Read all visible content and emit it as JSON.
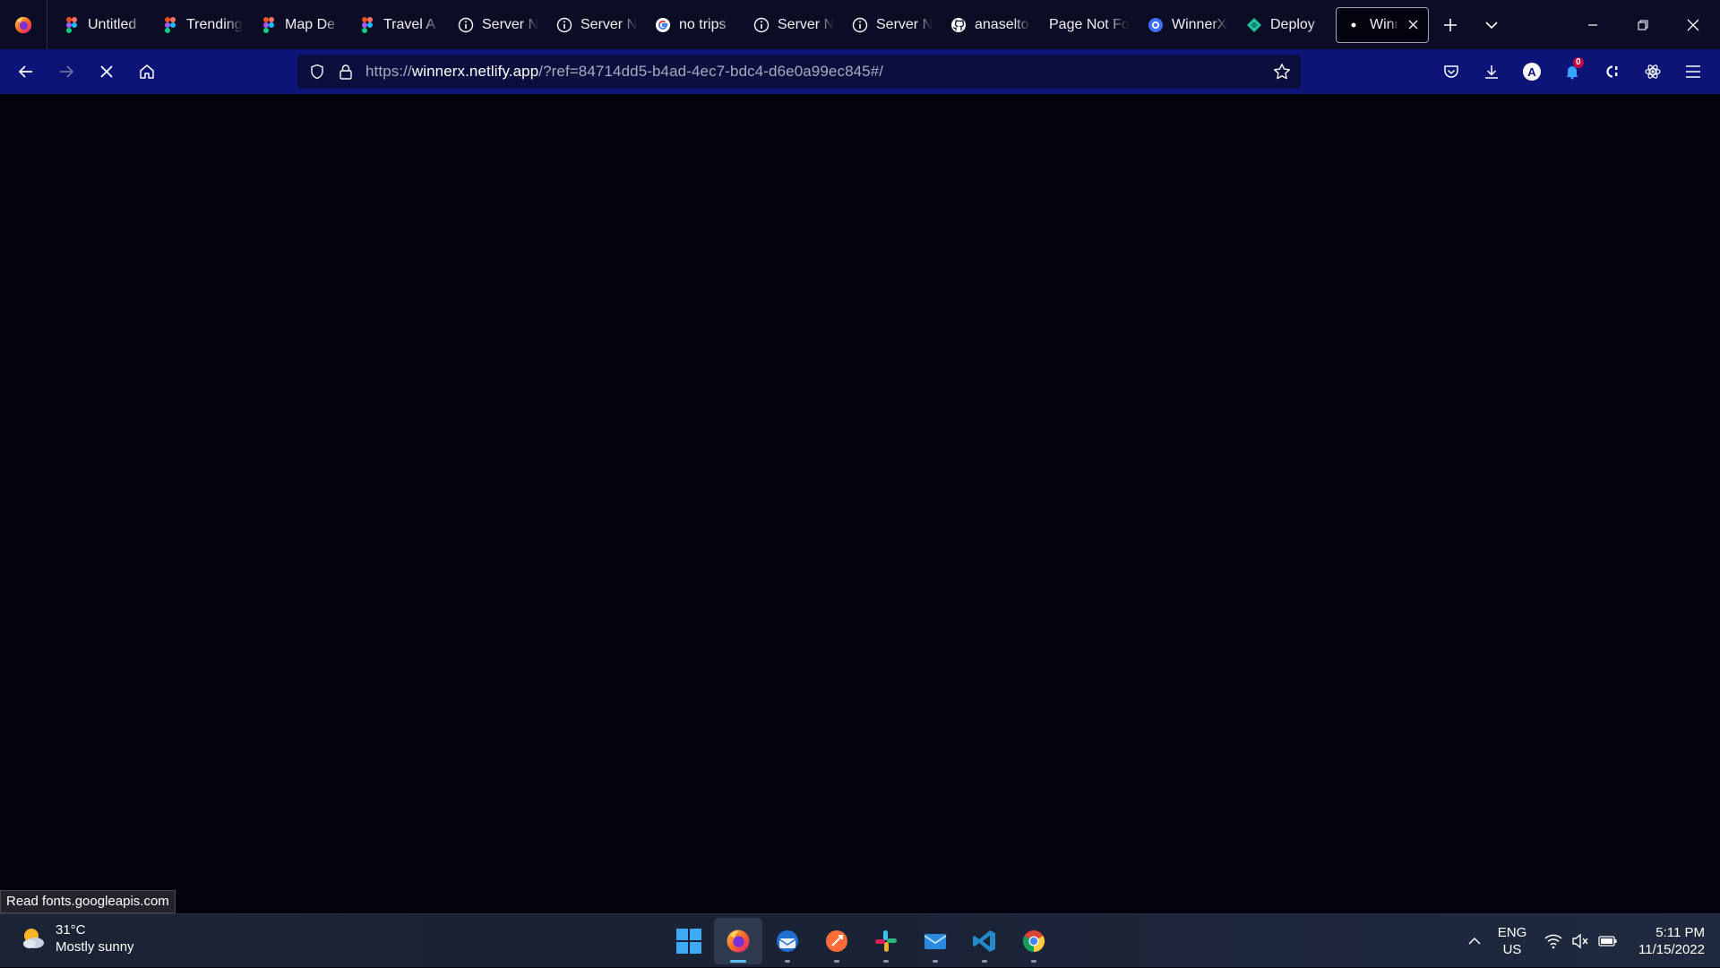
{
  "browser": {
    "tabs": [
      {
        "title": "Untitled",
        "icon": "figma-icon"
      },
      {
        "title": "Trending",
        "icon": "figma-icon"
      },
      {
        "title": "Map De",
        "icon": "figma-icon"
      },
      {
        "title": "Travel A",
        "icon": "figma-icon"
      },
      {
        "title": "Server N",
        "icon": "info-icon"
      },
      {
        "title": "Server N",
        "icon": "info-icon"
      },
      {
        "title": "no trips",
        "icon": "google-icon"
      },
      {
        "title": "Server N",
        "icon": "info-icon"
      },
      {
        "title": "Server N",
        "icon": "info-icon"
      },
      {
        "title": "anaselto",
        "icon": "github-icon"
      },
      {
        "title": "Page Not Fo",
        "icon": "none"
      },
      {
        "title": "WinnerX",
        "icon": "winnerx-icon"
      },
      {
        "title": "Deploy",
        "icon": "netlify-icon"
      },
      {
        "title": "Winne",
        "icon": "loading-dot-icon",
        "active": true
      }
    ],
    "url": {
      "scheme": "https://",
      "host": "winnerx.netlify.app",
      "path": "/?ref=84714dd5-b4ad-4ec7-bdc4-d6e0a99ec845#/"
    },
    "extension_badge": "0",
    "avatar_letter": "A",
    "status_tooltip": "Read fonts.googleapis.com"
  },
  "taskbar": {
    "weather": {
      "temp": "31°C",
      "condition": "Mostly sunny"
    },
    "language": {
      "line1": "ENG",
      "line2": "US"
    },
    "clock": {
      "time": "5:11 PM",
      "date": "11/15/2022"
    },
    "pinned_apps": [
      "start-icon",
      "firefox-icon",
      "thunderbird-icon",
      "postman-icon",
      "slack-icon",
      "mail-icon",
      "vscode-icon",
      "chrome-icon"
    ]
  },
  "colors": {
    "tabstrip": "#0b0d24",
    "navbar": "#0c1577",
    "content": "#02030d",
    "accent": "#60c0ff"
  }
}
